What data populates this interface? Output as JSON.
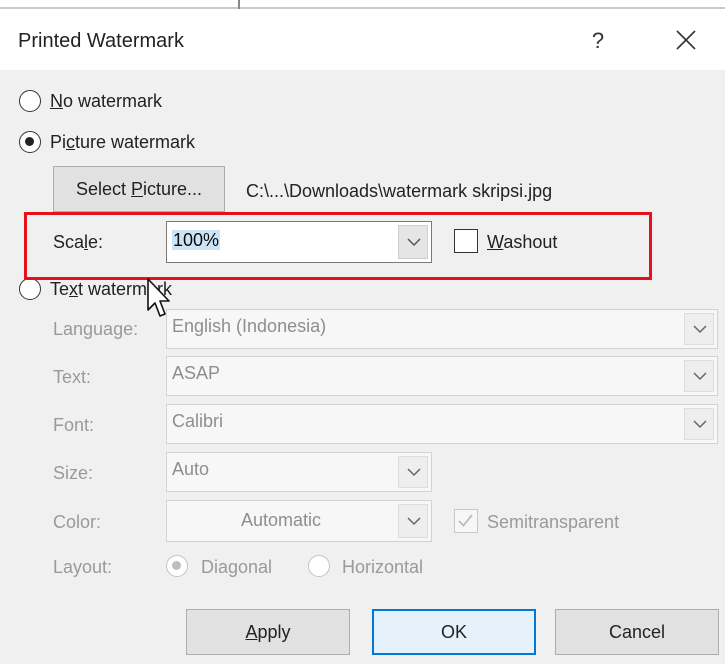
{
  "dialog": {
    "title": "Printed Watermark",
    "help_label": "?",
    "close_icon": "close-icon"
  },
  "options": {
    "no_watermark": {
      "prefix": "",
      "accel": "N",
      "rest": "o watermark",
      "checked": false
    },
    "picture_watermark": {
      "prefix": "Pi",
      "accel": "c",
      "rest": "ture watermark",
      "checked": true
    },
    "text_watermark": {
      "prefix": "Te",
      "accel": "x",
      "rest": "t watermark",
      "checked": false
    }
  },
  "picture": {
    "select_button": {
      "prefix": "Select ",
      "accel": "P",
      "rest": "icture..."
    },
    "path": "C:\\...\\Downloads\\watermark skripsi.jpg",
    "scale_label": {
      "prefix": "Sca",
      "accel": "l",
      "rest": "e:"
    },
    "scale_value": "100%",
    "washout_label": {
      "prefix": "",
      "accel": "W",
      "rest": "ashout"
    },
    "washout_checked": false
  },
  "text": {
    "language_label": "Language:",
    "language_value": "English (Indonesia)",
    "text_label": "Text:",
    "text_value": "ASAP",
    "font_label": "Font:",
    "font_value": "Calibri",
    "size_label": "Size:",
    "size_value": "Auto",
    "color_label": "Color:",
    "color_value": "Automatic",
    "semitransparent_label": "Semitransparent",
    "semitransparent_checked": true,
    "layout_label": "Layout:",
    "layout_diagonal": "Diagonal",
    "layout_horizontal": "Horizontal",
    "layout_selected": "Diagonal"
  },
  "buttons": {
    "apply": {
      "prefix": "",
      "accel": "A",
      "rest": "pply"
    },
    "ok": "OK",
    "cancel": "Cancel"
  },
  "colors": {
    "highlight_box": "#e8101b",
    "ok_border": "#0078d7",
    "selection": "#cce4f7"
  }
}
